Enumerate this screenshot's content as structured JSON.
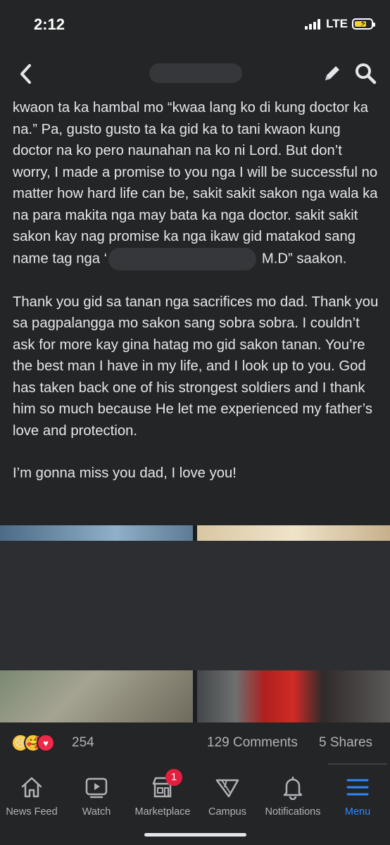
{
  "status_bar": {
    "time": "2:12",
    "network": "LTE",
    "battery_color": "#f4d22a"
  },
  "header": {
    "back_icon": "chevron-left-icon",
    "edit_icon": "pencil-icon",
    "search_icon": "search-icon"
  },
  "post": {
    "paragraph1_before": "kwaon ta ka hambal mo “kwaa lang ko di kung doctor ka na.” Pa, gusto gusto ta ka gid ka to tani kwaon kung doctor na ko pero naunahan na ko ni Lord. But don’t worry, I made a promise to you nga I will be successful no matter how hard life can be, sakit sakit sakon nga wala ka na para makita nga may bata ka nga doctor. sakit sakit sakon kay nag promise ka nga ikaw gid matakod sang name tag nga ‘",
    "paragraph1_after": " M.D” saakon.",
    "paragraph2": "Thank you gid sa tanan nga sacrifices mo dad. Thank you sa pagpalangga mo sakon sang sobra sobra. I couldn’t ask for more kay gina hatag mo gid sakon tanan. You’re the best man I have in my life, and I look up to you. God has taken back one of his strongest soldiers and I thank him so much because He let me experienced my father’s love and protection.",
    "paragraph3": "I’m gonna miss you dad, I love you!"
  },
  "reactions": {
    "icons": [
      "sad-reaction-icon",
      "care-reaction-icon",
      "love-reaction-icon"
    ],
    "count": "254",
    "comments": "129 Comments",
    "shares": "5 Shares"
  },
  "tab_bar": {
    "accent_color": "#2d88ff",
    "tabs": [
      {
        "label": "News Feed",
        "icon": "home-icon"
      },
      {
        "label": "Watch",
        "icon": "video-icon"
      },
      {
        "label": "Marketplace",
        "icon": "store-icon",
        "badge": "1"
      },
      {
        "label": "Campus",
        "icon": "campus-icon"
      },
      {
        "label": "Notifications",
        "icon": "bell-icon"
      },
      {
        "label": "Menu",
        "icon": "hamburger-menu-icon",
        "active": true
      }
    ]
  }
}
